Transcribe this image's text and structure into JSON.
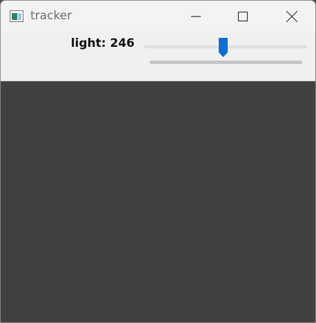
{
  "window": {
    "title": "tracker",
    "icon": "opencv-window-icon",
    "controls": {
      "minimize_icon": "minimize-icon",
      "maximize_icon": "maximize-icon",
      "close_icon": "close-icon"
    }
  },
  "trackbar": {
    "label": "light: 246",
    "value": 246,
    "slider_fraction": 0.485
  },
  "canvas": {
    "color": "#414141"
  },
  "colors": {
    "accent": "#0a6fd8"
  }
}
